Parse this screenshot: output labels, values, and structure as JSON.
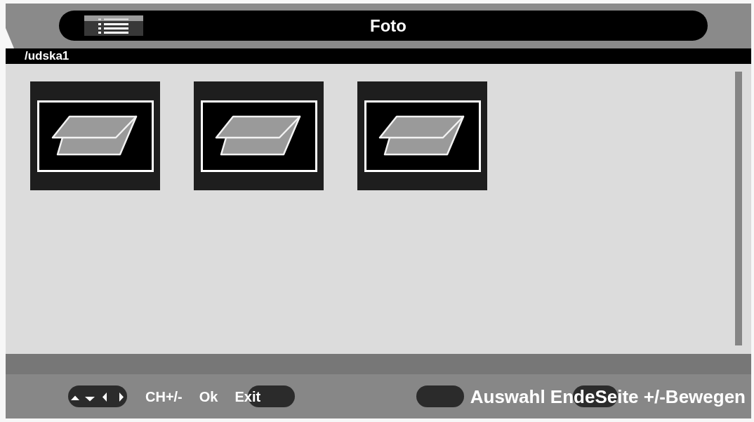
{
  "header": {
    "title": "Foto"
  },
  "path": "/udska1",
  "thumbnails": [
    {
      "kind": "photo"
    },
    {
      "kind": "photo"
    },
    {
      "kind": "photo"
    }
  ],
  "footer": {
    "hints": [
      {
        "kind": "arrows"
      },
      {
        "kind": "label",
        "text": "CH+/-"
      },
      {
        "kind": "label",
        "text": "Ok"
      },
      {
        "kind": "label",
        "text": "Exit"
      }
    ],
    "actions": [
      {
        "kind": "key"
      },
      {
        "kind": "caption",
        "text": "Auswahl Ende"
      },
      {
        "kind": "caption",
        "text": "Seite +/-Bewegen"
      }
    ]
  }
}
